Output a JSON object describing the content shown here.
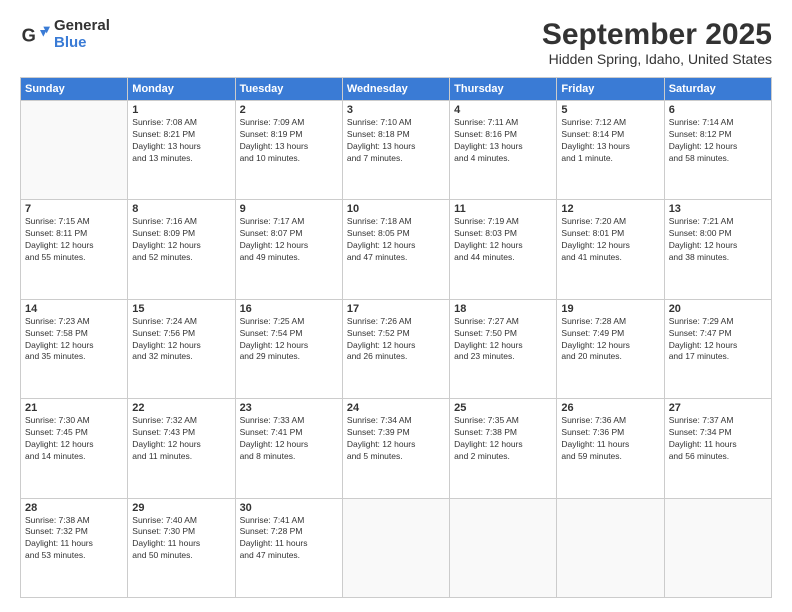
{
  "logo": {
    "general": "General",
    "blue": "Blue"
  },
  "title": "September 2025",
  "subtitle": "Hidden Spring, Idaho, United States",
  "days_of_week": [
    "Sunday",
    "Monday",
    "Tuesday",
    "Wednesday",
    "Thursday",
    "Friday",
    "Saturday"
  ],
  "weeks": [
    [
      {
        "day": "",
        "info": []
      },
      {
        "day": "1",
        "info": [
          "Sunrise: 7:08 AM",
          "Sunset: 8:21 PM",
          "Daylight: 13 hours",
          "and 13 minutes."
        ]
      },
      {
        "day": "2",
        "info": [
          "Sunrise: 7:09 AM",
          "Sunset: 8:19 PM",
          "Daylight: 13 hours",
          "and 10 minutes."
        ]
      },
      {
        "day": "3",
        "info": [
          "Sunrise: 7:10 AM",
          "Sunset: 8:18 PM",
          "Daylight: 13 hours",
          "and 7 minutes."
        ]
      },
      {
        "day": "4",
        "info": [
          "Sunrise: 7:11 AM",
          "Sunset: 8:16 PM",
          "Daylight: 13 hours",
          "and 4 minutes."
        ]
      },
      {
        "day": "5",
        "info": [
          "Sunrise: 7:12 AM",
          "Sunset: 8:14 PM",
          "Daylight: 13 hours",
          "and 1 minute."
        ]
      },
      {
        "day": "6",
        "info": [
          "Sunrise: 7:14 AM",
          "Sunset: 8:12 PM",
          "Daylight: 12 hours",
          "and 58 minutes."
        ]
      }
    ],
    [
      {
        "day": "7",
        "info": [
          "Sunrise: 7:15 AM",
          "Sunset: 8:11 PM",
          "Daylight: 12 hours",
          "and 55 minutes."
        ]
      },
      {
        "day": "8",
        "info": [
          "Sunrise: 7:16 AM",
          "Sunset: 8:09 PM",
          "Daylight: 12 hours",
          "and 52 minutes."
        ]
      },
      {
        "day": "9",
        "info": [
          "Sunrise: 7:17 AM",
          "Sunset: 8:07 PM",
          "Daylight: 12 hours",
          "and 49 minutes."
        ]
      },
      {
        "day": "10",
        "info": [
          "Sunrise: 7:18 AM",
          "Sunset: 8:05 PM",
          "Daylight: 12 hours",
          "and 47 minutes."
        ]
      },
      {
        "day": "11",
        "info": [
          "Sunrise: 7:19 AM",
          "Sunset: 8:03 PM",
          "Daylight: 12 hours",
          "and 44 minutes."
        ]
      },
      {
        "day": "12",
        "info": [
          "Sunrise: 7:20 AM",
          "Sunset: 8:01 PM",
          "Daylight: 12 hours",
          "and 41 minutes."
        ]
      },
      {
        "day": "13",
        "info": [
          "Sunrise: 7:21 AM",
          "Sunset: 8:00 PM",
          "Daylight: 12 hours",
          "and 38 minutes."
        ]
      }
    ],
    [
      {
        "day": "14",
        "info": [
          "Sunrise: 7:23 AM",
          "Sunset: 7:58 PM",
          "Daylight: 12 hours",
          "and 35 minutes."
        ]
      },
      {
        "day": "15",
        "info": [
          "Sunrise: 7:24 AM",
          "Sunset: 7:56 PM",
          "Daylight: 12 hours",
          "and 32 minutes."
        ]
      },
      {
        "day": "16",
        "info": [
          "Sunrise: 7:25 AM",
          "Sunset: 7:54 PM",
          "Daylight: 12 hours",
          "and 29 minutes."
        ]
      },
      {
        "day": "17",
        "info": [
          "Sunrise: 7:26 AM",
          "Sunset: 7:52 PM",
          "Daylight: 12 hours",
          "and 26 minutes."
        ]
      },
      {
        "day": "18",
        "info": [
          "Sunrise: 7:27 AM",
          "Sunset: 7:50 PM",
          "Daylight: 12 hours",
          "and 23 minutes."
        ]
      },
      {
        "day": "19",
        "info": [
          "Sunrise: 7:28 AM",
          "Sunset: 7:49 PM",
          "Daylight: 12 hours",
          "and 20 minutes."
        ]
      },
      {
        "day": "20",
        "info": [
          "Sunrise: 7:29 AM",
          "Sunset: 7:47 PM",
          "Daylight: 12 hours",
          "and 17 minutes."
        ]
      }
    ],
    [
      {
        "day": "21",
        "info": [
          "Sunrise: 7:30 AM",
          "Sunset: 7:45 PM",
          "Daylight: 12 hours",
          "and 14 minutes."
        ]
      },
      {
        "day": "22",
        "info": [
          "Sunrise: 7:32 AM",
          "Sunset: 7:43 PM",
          "Daylight: 12 hours",
          "and 11 minutes."
        ]
      },
      {
        "day": "23",
        "info": [
          "Sunrise: 7:33 AM",
          "Sunset: 7:41 PM",
          "Daylight: 12 hours",
          "and 8 minutes."
        ]
      },
      {
        "day": "24",
        "info": [
          "Sunrise: 7:34 AM",
          "Sunset: 7:39 PM",
          "Daylight: 12 hours",
          "and 5 minutes."
        ]
      },
      {
        "day": "25",
        "info": [
          "Sunrise: 7:35 AM",
          "Sunset: 7:38 PM",
          "Daylight: 12 hours",
          "and 2 minutes."
        ]
      },
      {
        "day": "26",
        "info": [
          "Sunrise: 7:36 AM",
          "Sunset: 7:36 PM",
          "Daylight: 11 hours",
          "and 59 minutes."
        ]
      },
      {
        "day": "27",
        "info": [
          "Sunrise: 7:37 AM",
          "Sunset: 7:34 PM",
          "Daylight: 11 hours",
          "and 56 minutes."
        ]
      }
    ],
    [
      {
        "day": "28",
        "info": [
          "Sunrise: 7:38 AM",
          "Sunset: 7:32 PM",
          "Daylight: 11 hours",
          "and 53 minutes."
        ]
      },
      {
        "day": "29",
        "info": [
          "Sunrise: 7:40 AM",
          "Sunset: 7:30 PM",
          "Daylight: 11 hours",
          "and 50 minutes."
        ]
      },
      {
        "day": "30",
        "info": [
          "Sunrise: 7:41 AM",
          "Sunset: 7:28 PM",
          "Daylight: 11 hours",
          "and 47 minutes."
        ]
      },
      {
        "day": "",
        "info": []
      },
      {
        "day": "",
        "info": []
      },
      {
        "day": "",
        "info": []
      },
      {
        "day": "",
        "info": []
      }
    ]
  ]
}
